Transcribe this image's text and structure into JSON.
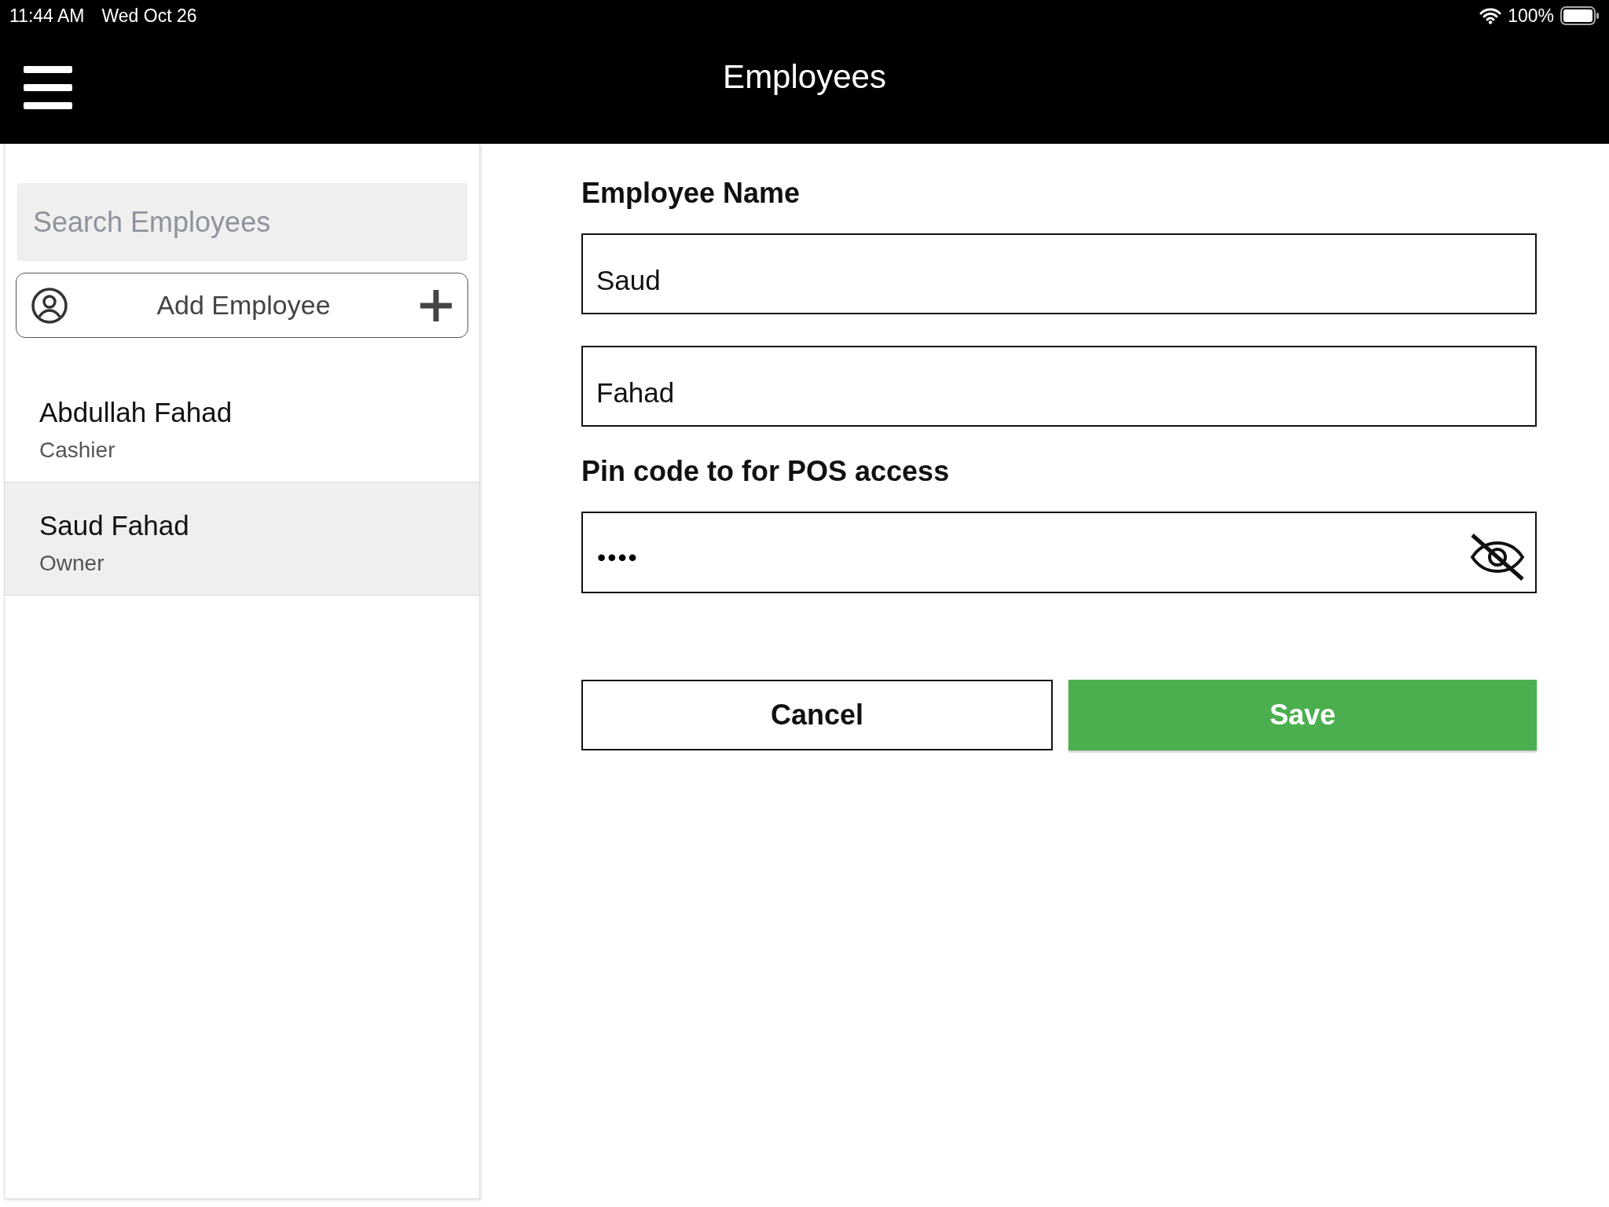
{
  "status_bar": {
    "time": "11:44 AM",
    "date": "Wed Oct 26",
    "battery": "100%"
  },
  "header": {
    "title": "Employees"
  },
  "sidebar": {
    "search": {
      "placeholder": "Search Employees"
    },
    "add_button": {
      "label": "Add Employee"
    },
    "employees": [
      {
        "name": "Abdullah Fahad",
        "role": "Cashier",
        "selected": false
      },
      {
        "name": "Saud Fahad",
        "role": "Owner",
        "selected": true
      }
    ]
  },
  "form": {
    "name_label": "Employee Name",
    "first_name": "Saud",
    "last_name": "Fahad",
    "pin_label": "Pin code to for POS access",
    "pin": "••••",
    "buttons": [
      {
        "kind": "secondary",
        "label": "Cancel"
      },
      {
        "kind": "primary",
        "label": "Save"
      }
    ]
  }
}
